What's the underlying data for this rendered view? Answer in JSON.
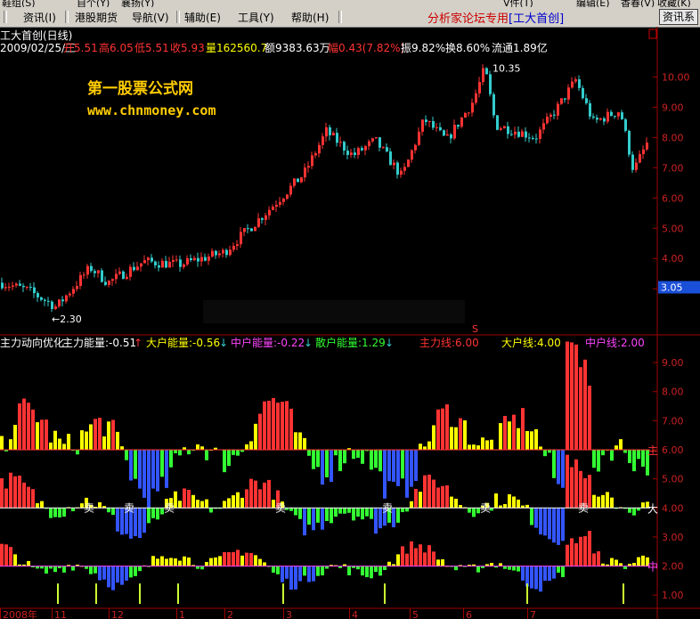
{
  "menu": {
    "top_row": [
      "鞋组(S)",
      "自个(Y)",
      "襄扬(Y)",
      "V件(T)",
      "编辑(E)",
      "香春(V)",
      "收藏(K)"
    ],
    "items": [
      "资讯(I)",
      "港股期货",
      "导航(V)",
      "辅助(E)",
      "工具(Y)",
      "帮助(H)"
    ],
    "promo": "分析家论坛专用",
    "promo_tag": "[工大首创]",
    "right_button": "资讯系"
  },
  "quote": {
    "title": "工大首创(日线)",
    "date": "2009/02/25/三",
    "open": "开5.51",
    "high": "高6.05",
    "low": "低5.51",
    "close": "收5.93",
    "volume": "量162560.7",
    "amount": "额9383.63万",
    "change": "幅0.43(7.82%)",
    "amplitude": "振9.82%",
    "turnover": "换8.60%",
    "float": "流通1.89亿"
  },
  "watermark": {
    "line1": "第一股票公式网",
    "line2": "www.chnmoney.com"
  },
  "colors": {
    "up": "#ff3333",
    "down": "#33cccc",
    "axis": "#a00000",
    "yellow": "#ffff00",
    "magenta": "#ff44ff",
    "green": "#33ff33",
    "blue": "#3355ff"
  },
  "chart_data": [
    {
      "type": "candlestick",
      "title": "工大首创(日线)",
      "ylim": [
        2.3,
        10.6
      ],
      "yticks": [
        "3.00",
        "4.00",
        "5.00",
        "6.00",
        "7.00",
        "8.00",
        "9.00",
        "10.00"
      ],
      "annotations": [
        {
          "label": "←2.30",
          "price": 2.3,
          "bar": 62
        },
        {
          "label": "10.35",
          "price": 10.35,
          "bar": 543
        }
      ],
      "current_price": "3.05",
      "marker": "S",
      "keypoints": [
        {
          "bar": 0,
          "price": 3.2
        },
        {
          "bar": 30,
          "price": 2.95
        },
        {
          "bar": 62,
          "price": 2.4
        },
        {
          "bar": 100,
          "price": 3.7
        },
        {
          "bar": 120,
          "price": 3.2
        },
        {
          "bar": 160,
          "price": 3.9
        },
        {
          "bar": 200,
          "price": 3.8
        },
        {
          "bar": 250,
          "price": 4.2
        },
        {
          "bar": 300,
          "price": 5.6
        },
        {
          "bar": 340,
          "price": 6.8
        },
        {
          "bar": 365,
          "price": 8.2
        },
        {
          "bar": 395,
          "price": 7.4
        },
        {
          "bar": 420,
          "price": 7.9
        },
        {
          "bar": 450,
          "price": 6.7
        },
        {
          "bar": 475,
          "price": 8.6
        },
        {
          "bar": 500,
          "price": 7.9
        },
        {
          "bar": 530,
          "price": 9.2
        },
        {
          "bar": 543,
          "price": 10.3
        },
        {
          "bar": 555,
          "price": 8.4
        },
        {
          "bar": 580,
          "price": 8.2
        },
        {
          "bar": 600,
          "price": 8.0
        },
        {
          "bar": 625,
          "price": 9.0
        },
        {
          "bar": 645,
          "price": 9.9
        },
        {
          "bar": 665,
          "price": 8.5
        },
        {
          "bar": 695,
          "price": 8.9
        },
        {
          "bar": 710,
          "price": 6.9
        },
        {
          "bar": 725,
          "price": 7.8
        }
      ]
    },
    {
      "type": "bar",
      "title": "主力动向优化",
      "series": [
        {
          "name": "主力能量",
          "label": "主力能量:-0.51",
          "arrow": "↑"
        },
        {
          "name": "大户能量",
          "label": "大户能量:-0.56",
          "arrow": "↓"
        },
        {
          "name": "中户能量",
          "label": "中户能量:-0.22",
          "arrow": "↓"
        },
        {
          "name": "散户能量",
          "label": "散户能量:1.29",
          "arrow": "↓"
        },
        {
          "name": "主力线",
          "label": "主力线:6.00",
          "value": 6.0
        },
        {
          "name": "大户线",
          "label": "大户线:4.00",
          "value": 4.0
        },
        {
          "name": "中户线",
          "label": "中户线:2.00",
          "value": 2.0
        }
      ],
      "ylim": [
        0.7,
        9.4
      ],
      "yticks": [
        "1.00",
        "2.00",
        "3.00",
        "4.00",
        "5.00",
        "6.00",
        "7.00",
        "8.00",
        "9.00"
      ],
      "line_markers": [
        "主",
        "大",
        "中"
      ],
      "sell_label": "卖",
      "sell_signals": [
        100,
        145,
        190,
        315,
        435,
        545,
        655
      ],
      "spikes": [
        65,
        108,
        157,
        200,
        318,
        432,
        592,
        700
      ]
    }
  ],
  "x_axis": {
    "labels": [
      "2008年",
      "11",
      "12",
      "1",
      "2",
      "3",
      "4",
      "5",
      "6",
      "7"
    ],
    "positions": [
      0,
      58,
      122,
      198,
      252,
      318,
      392,
      460,
      520,
      592
    ]
  }
}
